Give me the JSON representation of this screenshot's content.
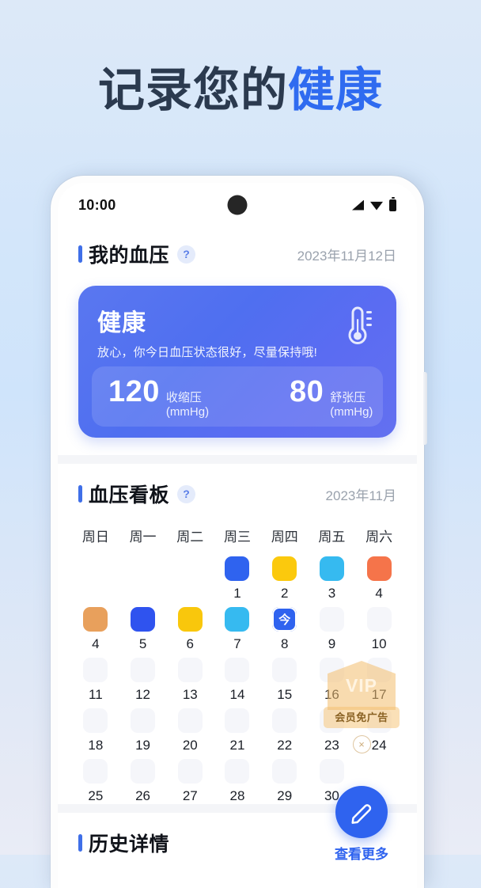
{
  "headline": {
    "text_plain": "记录您的",
    "text_accent": "健康",
    "accent_color": "#2f6bf0"
  },
  "status_bar": {
    "time": "10:00",
    "icons": [
      "signal-icon",
      "wifi-icon",
      "battery-icon"
    ]
  },
  "bp_section": {
    "title": "我的血压",
    "help": "?",
    "date": "2023年11月12日",
    "card": {
      "status": "健康",
      "message": "放心，你今日血压状态很好，尽量保持哦!",
      "icon": "thermometer-icon",
      "systolic_value": "120",
      "systolic_label": "收缩压(mmHg)",
      "diastolic_value": "80",
      "diastolic_label": "舒张压(mmHg)",
      "bg_color": "#5468f0"
    }
  },
  "calendar_section": {
    "title": "血压看板",
    "help": "?",
    "month": "2023年11月",
    "weekdays": [
      "周日",
      "周一",
      "周二",
      "周三",
      "周四",
      "周五",
      "周六"
    ],
    "leading_blanks": 3,
    "days": [
      {
        "num": "1",
        "color": "#2f63ef",
        "today": false
      },
      {
        "num": "2",
        "color": "#fbc90d",
        "today": false
      },
      {
        "num": "3",
        "color": "#36baf0",
        "today": false
      },
      {
        "num": "4",
        "color": "#f5744a",
        "today": false
      },
      {
        "num": "4",
        "color": "#e8a05c",
        "today": false
      },
      {
        "num": "5",
        "color": "#2f53ef",
        "today": false
      },
      {
        "num": "6",
        "color": "#f9c70c",
        "today": false
      },
      {
        "num": "7",
        "color": "#36baf0",
        "today": false
      },
      {
        "num": "8",
        "color": "#2f63ef",
        "today": true,
        "today_mark": "今"
      },
      {
        "num": "9",
        "color": "#f5f6fa",
        "today": false
      },
      {
        "num": "10",
        "color": "#f5f6fa",
        "today": false
      },
      {
        "num": "11",
        "color": "#f5f6fa",
        "today": false
      },
      {
        "num": "12",
        "color": "#f5f6fa",
        "today": false
      },
      {
        "num": "13",
        "color": "#f5f6fa",
        "today": false
      },
      {
        "num": "14",
        "color": "#f5f6fa",
        "today": false
      },
      {
        "num": "15",
        "color": "#f5f6fa",
        "today": false
      },
      {
        "num": "16",
        "color": "#f5f6fa",
        "today": false
      },
      {
        "num": "17",
        "color": "#f5f6fa",
        "today": false
      },
      {
        "num": "18",
        "color": "#f5f6fa",
        "today": false
      },
      {
        "num": "19",
        "color": "#f5f6fa",
        "today": false
      },
      {
        "num": "20",
        "color": "#f5f6fa",
        "today": false
      },
      {
        "num": "21",
        "color": "#f5f6fa",
        "today": false
      },
      {
        "num": "22",
        "color": "#f5f6fa",
        "today": false
      },
      {
        "num": "23",
        "color": "#f5f6fa",
        "today": false
      },
      {
        "num": "24",
        "color": "#f5f6fa",
        "today": false
      },
      {
        "num": "25",
        "color": "#f5f6fa",
        "today": false
      },
      {
        "num": "26",
        "color": "#f5f6fa",
        "today": false
      },
      {
        "num": "27",
        "color": "#f5f6fa",
        "today": false
      },
      {
        "num": "28",
        "color": "#f5f6fa",
        "today": false
      },
      {
        "num": "29",
        "color": "#f5f6fa",
        "today": false
      },
      {
        "num": "30",
        "color": "#f5f6fa",
        "today": false
      }
    ]
  },
  "vip_ad": {
    "badge": "VIP",
    "ribbon": "会员免广告",
    "close": "×"
  },
  "fab": {
    "icon": "pencil-icon",
    "label": "查看更多",
    "color": "#2f63ef"
  },
  "history_section": {
    "title": "历史详情"
  }
}
